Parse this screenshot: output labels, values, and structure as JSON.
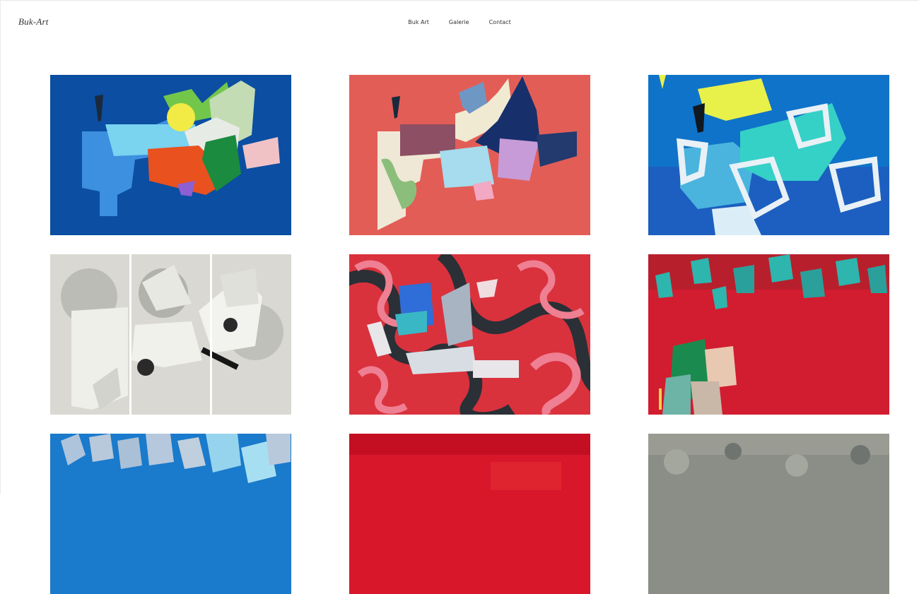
{
  "site": {
    "brand": "Buk-Art"
  },
  "nav": {
    "items": [
      "Buk Art",
      "Galerie",
      "Contact"
    ]
  },
  "gallery": {
    "artworks": [
      {
        "row": 1,
        "col": 1,
        "palette": [
          "#0b4ea2",
          "#7ad3ef",
          "#e9511f",
          "#1b8b3f",
          "#f0c2c6"
        ]
      },
      {
        "row": 1,
        "col": 2,
        "palette": [
          "#e35d57",
          "#17306b",
          "#c79bd8",
          "#a6dced",
          "#f0ead2"
        ]
      },
      {
        "row": 1,
        "col": 3,
        "palette": [
          "#0f73c9",
          "#4ab4de",
          "#35d0c6",
          "#e8f04a",
          "#e9f1f6"
        ]
      },
      {
        "row": 2,
        "col": 1,
        "palette": [
          "#d9d8d2",
          "#eeeee9",
          "#161616"
        ]
      },
      {
        "row": 2,
        "col": 2,
        "palette": [
          "#d9323d",
          "#2b2f36",
          "#ef7f92",
          "#2f6ed8",
          "#d8dde3"
        ]
      },
      {
        "row": 2,
        "col": 3,
        "palette": [
          "#d21c2f",
          "#2eb5ad",
          "#1b8a4e",
          "#e8c8b0"
        ]
      },
      {
        "row": 3,
        "col": 1,
        "palette": [
          "#1a7acb",
          "#96d4ee",
          "#cfdff0"
        ]
      },
      {
        "row": 3,
        "col": 2,
        "palette": [
          "#d8172a",
          "#c40f22"
        ]
      },
      {
        "row": 3,
        "col": 3,
        "palette": [
          "#8a8e86",
          "#a4a79d",
          "#6f7470"
        ]
      }
    ]
  }
}
